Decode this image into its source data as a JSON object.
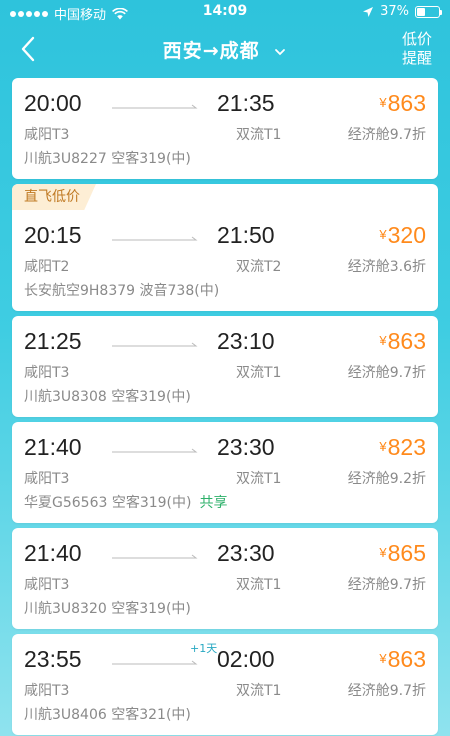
{
  "status_bar": {
    "carrier": "中国移动",
    "time": "14:09",
    "battery": "37%",
    "battery_level": 0.37
  },
  "nav": {
    "title": "西安→成都",
    "alert_line1": "低价",
    "alert_line2": "提醒"
  },
  "flights": [
    {
      "dep_time": "20:00",
      "arr_time": "21:35",
      "dep_airport": "咸阳T3",
      "arr_airport": "双流T1",
      "price": "863",
      "cabin": "经济舱9.7折",
      "flight_info": "川航3U8227  空客319(中)",
      "badge": "",
      "plus_day": "",
      "share": ""
    },
    {
      "dep_time": "20:15",
      "arr_time": "21:50",
      "dep_airport": "咸阳T2",
      "arr_airport": "双流T2",
      "price": "320",
      "cabin": "经济舱3.6折",
      "flight_info": "长安航空9H8379  波音738(中)",
      "badge": "直飞低价",
      "plus_day": "",
      "share": ""
    },
    {
      "dep_time": "21:25",
      "arr_time": "23:10",
      "dep_airport": "咸阳T3",
      "arr_airport": "双流T1",
      "price": "863",
      "cabin": "经济舱9.7折",
      "flight_info": "川航3U8308  空客319(中)",
      "badge": "",
      "plus_day": "",
      "share": ""
    },
    {
      "dep_time": "21:40",
      "arr_time": "23:30",
      "dep_airport": "咸阳T3",
      "arr_airport": "双流T1",
      "price": "823",
      "cabin": "经济舱9.2折",
      "flight_info": "华夏G56563  空客319(中)",
      "badge": "",
      "plus_day": "",
      "share": "共享"
    },
    {
      "dep_time": "21:40",
      "arr_time": "23:30",
      "dep_airport": "咸阳T3",
      "arr_airport": "双流T1",
      "price": "865",
      "cabin": "经济舱9.7折",
      "flight_info": "川航3U8320  空客319(中)",
      "badge": "",
      "plus_day": "",
      "share": ""
    },
    {
      "dep_time": "23:55",
      "arr_time": "02:00",
      "dep_airport": "咸阳T3",
      "arr_airport": "双流T1",
      "price": "863",
      "cabin": "经济舱9.7折",
      "flight_info": "川航3U8406  空客321(中)",
      "badge": "",
      "plus_day": "+1天",
      "share": ""
    }
  ],
  "currency_symbol": "¥",
  "colors": {
    "accent": "#2ec3dc",
    "price": "#ff8a1c",
    "badge_bg": "#fdeed5",
    "badge_text": "#c07a24",
    "share": "#2db06a"
  }
}
